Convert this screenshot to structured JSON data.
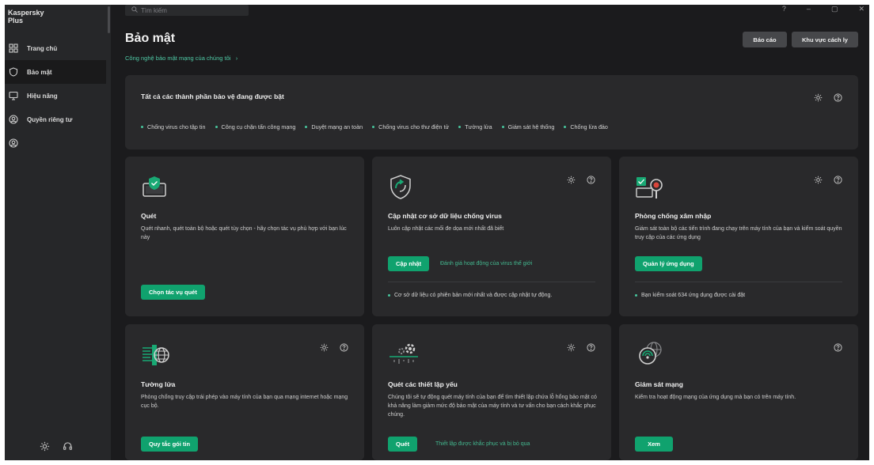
{
  "app": {
    "brand": "Kaspersky Plus"
  },
  "sidebar": {
    "items": [
      {
        "label": "Trang chủ",
        "icon": "home-grid-icon"
      },
      {
        "label": "Bảo mật",
        "icon": "shield-icon"
      },
      {
        "label": "Hiệu năng",
        "icon": "monitor-icon"
      },
      {
        "label": "Quyền riêng tư",
        "icon": "privacy-icon"
      }
    ],
    "bottom_icons": [
      "settings-icon",
      "support-headset-icon"
    ]
  },
  "search": {
    "placeholder": "Tìm kiếm"
  },
  "window_controls": [
    "?",
    "–",
    "▢",
    "✕"
  ],
  "header": {
    "title": "Bảo mật",
    "subtitle_link": "Công nghệ bảo mật mạng của chúng tôi",
    "report_button": "Báo cáo",
    "quarantine_button": "Khu vực cách ly"
  },
  "status": {
    "title": "Tất cả các thành phần bảo vệ đang được bật",
    "components": [
      "Chống virus cho tập tin",
      "Công cụ chặn tấn công mạng",
      "Duyệt mạng an toàn",
      "Chống virus cho thư điện tử",
      "Tường lửa",
      "Giám sát hệ thống",
      "Chống lừa đảo"
    ]
  },
  "cards": {
    "scan": {
      "title": "Quét",
      "desc": "Quét nhanh, quét toàn bộ hoặc quét tùy chọn - hãy chọn tác vụ phù hợp với bạn lúc này",
      "button": "Chọn tác vụ quét"
    },
    "update": {
      "title": "Cập nhật cơ sở dữ liệu chống virus",
      "desc": "Luôn cập nhật các mối đe dọa mới nhất đã biết",
      "button": "Cập nhật",
      "link": "Đánh giá hoạt động của virus thế giới",
      "footer": "Cơ sở dữ liệu có phiên bản mới nhất và được cập nhật tự động."
    },
    "intrusion": {
      "title": "Phòng chống xâm nhập",
      "desc": "Giám sát toàn bộ các tiến trình đang chạy trên máy tính của bạn và kiểm soát quyền truy cập của các ứng dụng",
      "button": "Quản lý ứng dụng",
      "footer": "Bạn kiểm soát 634 ứng dụng được cài đặt"
    },
    "firewall": {
      "title": "Tường lửa",
      "desc": "Phòng chống truy cập trái phép vào máy tính của bạn qua mạng internet hoặc mạng cục bộ.",
      "button": "Quy tắc gói tin"
    },
    "weak_settings": {
      "title": "Quét các thiết lập yếu",
      "desc": "Chúng tôi sẽ tự động quét máy tính của bạn để tìm thiết lập chứa lỗ hổng bảo mật có khả năng làm giảm mức độ bảo mật của máy tính và tư vấn cho bạn cách khắc phục chúng.",
      "button": "Quét",
      "link": "Thiết lập được khắc phục và bị bỏ qua"
    },
    "network": {
      "title": "Giám sát mạng",
      "desc": "Kiểm tra hoạt động mạng của ứng dụng mà bạn có trên máy tính.",
      "button": "Xem"
    }
  },
  "colors": {
    "accent_green": "#10a26e",
    "link_green": "#4fcaa6",
    "card_bg": "#29292b",
    "app_bg": "#1b1b1d"
  }
}
